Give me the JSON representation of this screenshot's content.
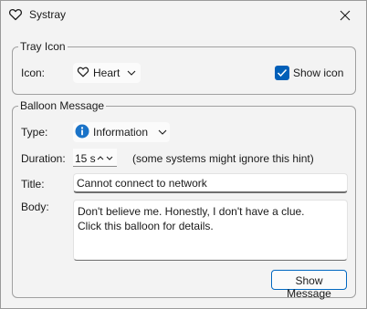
{
  "window": {
    "title": "Systray",
    "title_icon": "heart-icon",
    "close_icon": "close-icon"
  },
  "tray_icon": {
    "group_title": "Tray Icon",
    "icon_label": "Icon:",
    "icon_value": "Heart",
    "icon_glyph": "heart-icon",
    "show_icon_label": "Show icon",
    "show_icon_checked": true
  },
  "balloon": {
    "group_title": "Balloon Message",
    "type_label": "Type:",
    "type_value": "Information",
    "type_glyph": "information-icon",
    "duration_label": "Duration:",
    "duration_value": "15 s",
    "duration_hint": "(some systems might ignore this hint)",
    "title_label": "Title:",
    "title_value": "Cannot connect to network",
    "body_label": "Body:",
    "body_lines": [
      "Don't believe me. Honestly, I don't have a clue.",
      "Click this balloon for details."
    ],
    "show_button": "Show Message"
  },
  "colors": {
    "accent": "#005fb8",
    "info_blue": "#1a73c8",
    "window_bg": "#f3f3f3"
  }
}
